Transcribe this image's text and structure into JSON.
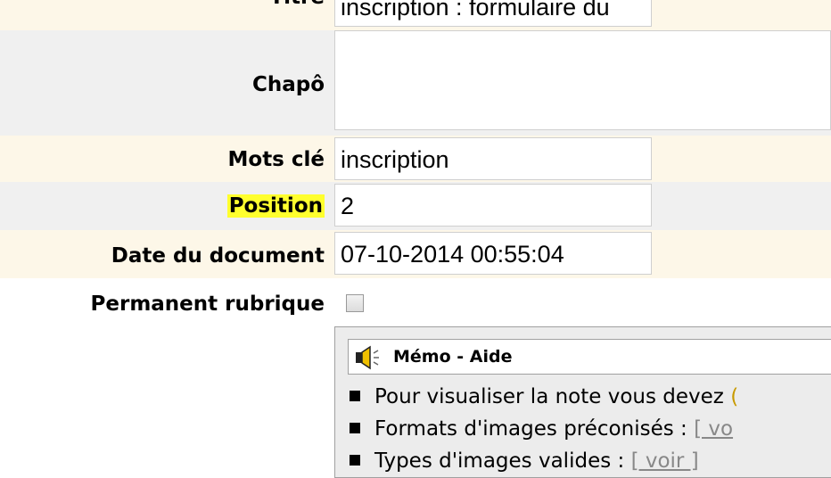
{
  "form": {
    "titre": {
      "label": "Titre",
      "value": "inscription : formulaire du"
    },
    "chapo": {
      "label": "Chapô",
      "value": ""
    },
    "mots_cle": {
      "label": "Mots clé",
      "value": "inscription"
    },
    "position": {
      "label": "Position",
      "value": "2"
    },
    "date": {
      "label": "Date du document",
      "value": "07-10-2014 00:55:04"
    },
    "permanent": {
      "label": "Permanent rubrique",
      "checked": false
    }
  },
  "memo": {
    "title": "Mémo - Aide",
    "items": [
      {
        "text": "Pour visualiser la note vous devez ",
        "link": ""
      },
      {
        "text": "Formats d'images préconisés : ",
        "link": "[ vo"
      },
      {
        "text": "Types d'images valides : ",
        "link": "[ voir ]"
      }
    ]
  },
  "colors": {
    "beige": "#fdf7e8",
    "grey": "#f0f0f0",
    "highlight": "#ffff2e"
  }
}
